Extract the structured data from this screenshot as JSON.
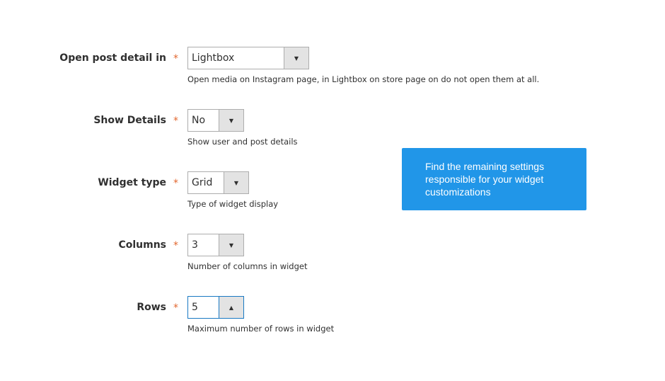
{
  "fields": [
    {
      "label": "Open post detail in",
      "required_mark": "*",
      "value": "Lightbox",
      "arrow": "▼",
      "arrow_icon": "chevron-down-icon",
      "note": "Open media on Instagram page, in Lightbox on store page on do not open them at all."
    },
    {
      "label": "Show Details",
      "required_mark": "*",
      "value": "No",
      "arrow": "▼",
      "arrow_icon": "chevron-down-icon",
      "note": "Show user and post details"
    },
    {
      "label": "Widget type",
      "required_mark": "*",
      "value": "Grid",
      "arrow": "▼",
      "arrow_icon": "chevron-down-icon",
      "note": "Type of widget display"
    },
    {
      "label": "Columns",
      "required_mark": "*",
      "value": "3",
      "arrow": "▼",
      "arrow_icon": "chevron-down-icon",
      "note": "Number of columns in widget"
    },
    {
      "label": "Rows",
      "required_mark": "*",
      "value": "5",
      "arrow": "▲",
      "arrow_icon": "chevron-up-icon",
      "note": "Maximum number of rows in widget"
    }
  ],
  "tooltip": {
    "text": "Find the remaining settings responsible for your widget customizations"
  },
  "colors": {
    "required": "#e2672f",
    "tooltip_bg": "#2196e8",
    "focus_border": "#1979c3"
  }
}
